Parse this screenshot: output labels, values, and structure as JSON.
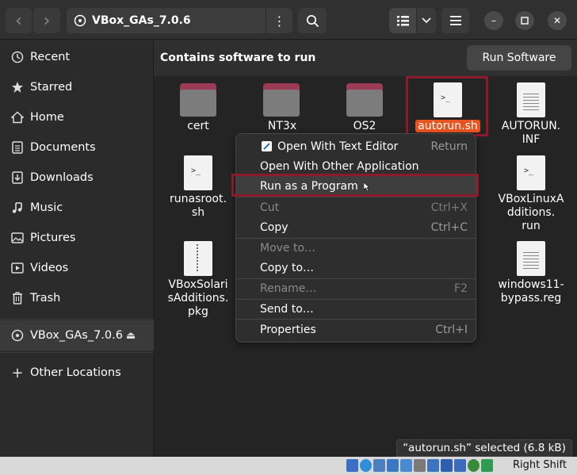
{
  "header": {
    "back_glyph": "‹",
    "forward_glyph": "›",
    "path": "VBox_GAs_7.0.6",
    "path_menu_glyph": "⋮",
    "view_list_glyph": "☰",
    "view_dropdown_glyph": "⌄",
    "hamburger_glyph": "≡",
    "minimize_glyph": "–",
    "maximize_glyph": "▫",
    "close_glyph": "✕"
  },
  "sidebar": {
    "items": [
      {
        "label": "Recent",
        "icon": "clock-icon"
      },
      {
        "label": "Starred",
        "icon": "star-icon"
      },
      {
        "label": "Home",
        "icon": "home-icon"
      },
      {
        "label": "Documents",
        "icon": "document-icon"
      },
      {
        "label": "Downloads",
        "icon": "download-icon"
      },
      {
        "label": "Music",
        "icon": "music-icon"
      },
      {
        "label": "Pictures",
        "icon": "picture-icon"
      },
      {
        "label": "Videos",
        "icon": "video-icon"
      },
      {
        "label": "Trash",
        "icon": "trash-icon"
      }
    ],
    "device": {
      "label": "VBox_GAs_7.0.6",
      "eject_glyph": "⏏"
    },
    "other": {
      "label": "Other Locations",
      "glyph": "+"
    }
  },
  "banner": {
    "text": "Contains software to run",
    "button": "Run Software"
  },
  "files": {
    "cert": "cert",
    "nt3x": "NT3x",
    "os2": "OS2",
    "autorun_sh": "autorun.sh",
    "autorun_inf_1": "AUTORUN.",
    "autorun_inf_2": "INF",
    "runasroot_1": "runasroot.",
    "runasroot_2": "sh",
    "vboxlinux_1": "VBoxLinuxA",
    "vboxlinux_2": "dditions.",
    "vboxlinux_3": "run",
    "vboxsolaris_1": "VBoxSolari",
    "vboxsolaris_2": "sAdditions.",
    "vboxsolaris_3": "pkg",
    "win11_1": "windows11-",
    "win11_2": "bypass.reg",
    "term_glyph": ">_"
  },
  "context_menu": {
    "items": [
      {
        "label": "Open With Text Editor",
        "shortcut": "Return"
      },
      {
        "label": "Open With Other Application",
        "shortcut": ""
      },
      {
        "label": "Run as a Program",
        "shortcut": ""
      },
      {
        "label": "Cut",
        "shortcut": "Ctrl+X"
      },
      {
        "label": "Copy",
        "shortcut": "Ctrl+C"
      },
      {
        "label": "Move to…",
        "shortcut": ""
      },
      {
        "label": "Copy to…",
        "shortcut": ""
      },
      {
        "label": "Rename…",
        "shortcut": "F2"
      },
      {
        "label": "Send to…",
        "shortcut": ""
      },
      {
        "label": "Properties",
        "shortcut": "Ctrl+I"
      }
    ]
  },
  "status": {
    "text": "“autorun.sh” selected  (6.8 kB)"
  },
  "vbox": {
    "host_key": "Right Shift"
  },
  "colors": {
    "accent": "#e95420",
    "highlight_box": "#8b1a2c",
    "folder_tab": "#9b3b55"
  }
}
